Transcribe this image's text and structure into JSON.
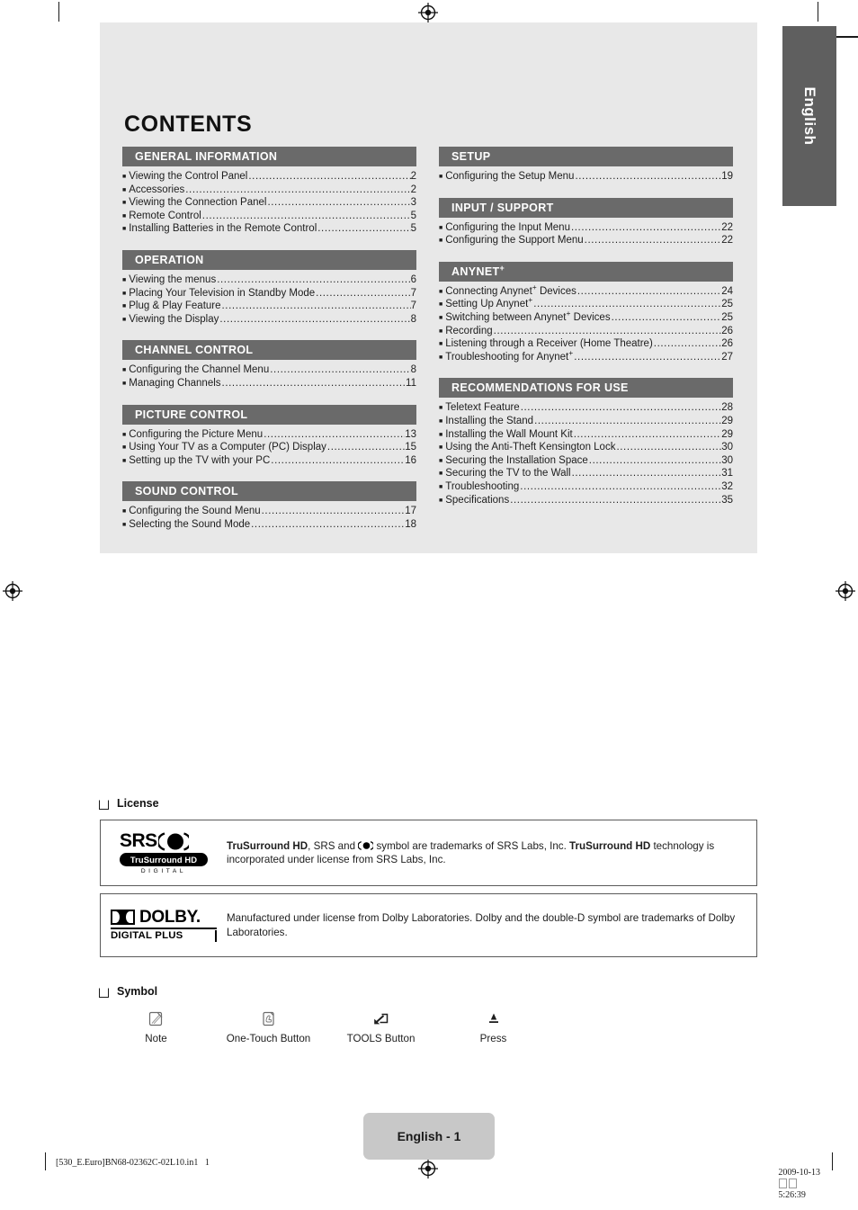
{
  "language_tab": {
    "label": "English"
  },
  "page_title": "CONTENTS",
  "toc": {
    "left_column": [
      {
        "header": "GENERAL INFORMATION",
        "items": [
          {
            "text": "Viewing the Control Panel",
            "page": "2"
          },
          {
            "text": "Accessories",
            "page": "2"
          },
          {
            "text": "Viewing the Connection Panel",
            "page": "3"
          },
          {
            "text": "Remote Control",
            "page": "5"
          },
          {
            "text": "Installing Batteries in the Remote Control",
            "page": "5"
          }
        ]
      },
      {
        "header": "OPERATION",
        "items": [
          {
            "text": "Viewing the menus",
            "page": "6"
          },
          {
            "text": "Placing Your Television in Standby Mode",
            "page": "7"
          },
          {
            "text": "Plug & Play Feature",
            "page": "7"
          },
          {
            "text": "Viewing the Display",
            "page": "8"
          }
        ]
      },
      {
        "header": "CHANNEL CONTROL",
        "items": [
          {
            "text": "Configuring the Channel Menu",
            "page": "8"
          },
          {
            "text": "Managing Channels",
            "page": "11"
          }
        ]
      },
      {
        "header": "PICTURE CONTROL",
        "items": [
          {
            "text": "Configuring the Picture Menu",
            "page": "13"
          },
          {
            "text": "Using Your TV as a Computer (PC) Display",
            "page": "15"
          },
          {
            "text": "Setting up the TV with your PC",
            "page": "16"
          }
        ]
      },
      {
        "header": "SOUND CONTROL",
        "items": [
          {
            "text": "Configuring the Sound Menu",
            "page": "17"
          },
          {
            "text": "Selecting the Sound Mode",
            "page": "18"
          }
        ]
      }
    ],
    "right_column": [
      {
        "header": "SETUP",
        "items": [
          {
            "text": "Configuring the Setup Menu",
            "page": "19"
          }
        ]
      },
      {
        "header": "INPUT / SUPPORT",
        "items": [
          {
            "text": "Configuring the Input Menu",
            "page": "22"
          },
          {
            "text": "Configuring the Support Menu",
            "page": "22"
          }
        ]
      },
      {
        "header": "ANYNET",
        "header_sup": "+",
        "items": [
          {
            "text": "Connecting Anynet",
            "sup": "+",
            "text_after": " Devices",
            "page": "24"
          },
          {
            "text": "Setting Up Anynet",
            "sup": "+",
            "text_after": "",
            "page": "25"
          },
          {
            "text": "Switching between Anynet",
            "sup": "+",
            "text_after": " Devices",
            "page": "25"
          },
          {
            "text": "Recording",
            "page": "26"
          },
          {
            "text": "Listening through a Receiver (Home Theatre)",
            "page": "26"
          },
          {
            "text": "Troubleshooting for Anynet",
            "sup": "+",
            "text_after": "",
            "page": "27"
          }
        ]
      },
      {
        "header": "RECOMMENDATIONS FOR USE",
        "items": [
          {
            "text": "Teletext Feature",
            "page": "28"
          },
          {
            "text": "Installing the Stand",
            "page": "29"
          },
          {
            "text": "Installing the Wall Mount Kit",
            "page": "29"
          },
          {
            "text": "Using the Anti-Theft Kensington Lock",
            "page": "30"
          },
          {
            "text": "Securing the Installation Space",
            "page": "30"
          },
          {
            "text": "Securing the TV to the Wall",
            "page": "31"
          },
          {
            "text": "Troubleshooting",
            "page": "32"
          },
          {
            "text": "Specifications",
            "page": "35"
          }
        ]
      }
    ]
  },
  "license": {
    "label": "License",
    "entries": [
      {
        "logo": "srs-trusurround-hd-logo",
        "logo_word": "SRS",
        "logo_pill": "TruSurround HD",
        "logo_sub": "DIGITAL",
        "text_bold_1": "TruSurround HD",
        "text_mid": ", SRS and ",
        "text_mid_2": " symbol are trademarks of SRS Labs, Inc. ",
        "text_bold_2": "TruSurround HD",
        "text_end": " technology is incorporated under license from SRS Labs, Inc."
      },
      {
        "logo": "dolby-digital-plus-logo",
        "logo_word": "DOLBY.",
        "logo_sub": "DIGITAL PLUS",
        "text": "Manufactured under license from Dolby Laboratories. Dolby and the double-D symbol are trademarks of Dolby Laboratories."
      }
    ]
  },
  "symbol": {
    "label": "Symbol",
    "items": [
      {
        "icon": "note-icon",
        "name": "Note"
      },
      {
        "icon": "one-touch-button-icon",
        "name": "One-Touch Button"
      },
      {
        "icon": "tools-button-icon",
        "name": "TOOLS Button"
      },
      {
        "icon": "press-icon",
        "name": "Press"
      }
    ]
  },
  "footer": {
    "page_label": "English - 1",
    "print_left": "[530_E.Euro]BN68-02362C-02L10.in1   1",
    "print_right_date": "2009-10-13",
    "print_right_time": "5:26:39"
  },
  "colors": {
    "panel_bg": "#e8e8e8",
    "group_header_bg": "#6a6a6a",
    "lang_tab_bg": "#5f5f5f",
    "page_pill_bg": "#c8c8c8",
    "text": "#1d1d1d"
  }
}
